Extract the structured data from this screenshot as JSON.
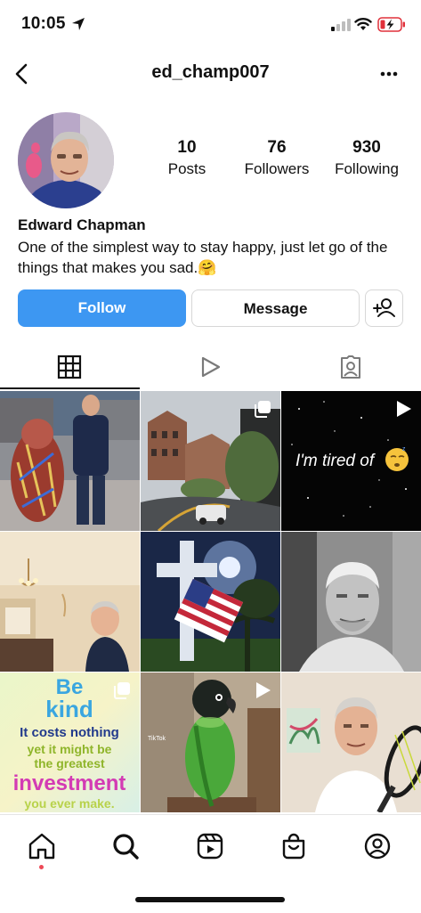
{
  "status_bar": {
    "time": "10:05"
  },
  "header": {
    "username": "ed_champ007"
  },
  "profile": {
    "name": "Edward Chapman",
    "bio": "One of the simplest way to stay happy, just let go of the things that makes you sad.🤗",
    "stats": [
      {
        "value": "10",
        "label": "Posts"
      },
      {
        "value": "76",
        "label": "Followers"
      },
      {
        "value": "930",
        "label": "Following"
      }
    ]
  },
  "actions": {
    "follow": "Follow",
    "message": "Message"
  },
  "tabs": [
    "grid-icon",
    "reels-icon",
    "tagged-icon"
  ],
  "posts": {
    "tired_text": "I'm tired of",
    "kind_line1": "Be",
    "kind_line2": "kind",
    "kind_line3": "It costs nothing",
    "kind_line4": "yet it might be",
    "kind_line5": "the greatest",
    "kind_line6": "investment",
    "kind_line7": "you ever make.",
    "parrot_watermark": "TikTok"
  },
  "bottom_nav": [
    "home-icon",
    "search-icon",
    "reels-icon",
    "shop-icon",
    "profile-icon"
  ],
  "colors": {
    "accent": "#3d97f2",
    "notification": "#ed4956"
  }
}
